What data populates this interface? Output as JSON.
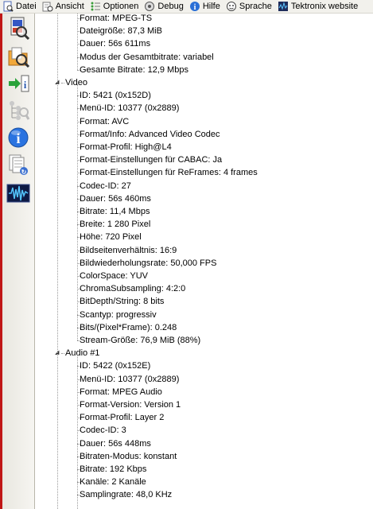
{
  "menu": [
    {
      "label": "Datei",
      "icon": "file-icon"
    },
    {
      "label": "Ansicht",
      "icon": "view-icon"
    },
    {
      "label": "Optionen",
      "icon": "options-icon"
    },
    {
      "label": "Debug",
      "icon": "debug-icon"
    },
    {
      "label": "Hilfe",
      "icon": "info-icon"
    },
    {
      "label": "Sprache",
      "icon": "language-icon"
    },
    {
      "label": "Tektronix website",
      "icon": "tektronix-icon"
    }
  ],
  "toolbar": [
    {
      "name": "open-file-icon"
    },
    {
      "name": "open-folder-icon"
    },
    {
      "name": "export-info-icon"
    },
    {
      "name": "tree-view-icon"
    },
    {
      "name": "about-icon"
    },
    {
      "name": "sheet-view-icon"
    },
    {
      "name": "waveform-icon"
    }
  ],
  "general_items": [
    "Format: MPEG-TS",
    "Dateigröße: 87,3 MiB",
    "Dauer: 56s 611ms",
    "Modus der Gesamtbitrate: variabel",
    "Gesamte Bitrate: 12,9 Mbps"
  ],
  "sections": [
    {
      "title": "Video",
      "items": [
        "ID: 5421 (0x152D)",
        "Menü-ID: 10377 (0x2889)",
        "Format: AVC",
        "Format/Info: Advanced Video Codec",
        "Format-Profil: High@L4",
        "Format-Einstellungen für CABAC: Ja",
        "Format-Einstellungen für ReFrames: 4 frames",
        "Codec-ID: 27",
        "Dauer: 56s 460ms",
        "Bitrate: 11,4 Mbps",
        "Breite: 1 280 Pixel",
        "Höhe: 720 Pixel",
        "Bildseitenverhältnis: 16:9",
        "Bildwiederholungsrate: 50,000 FPS",
        "ColorSpace: YUV",
        "ChromaSubsampling: 4:2:0",
        "BitDepth/String: 8 bits",
        "Scantyp: progressiv",
        "Bits/(Pixel*Frame): 0.248",
        "Stream-Größe: 76,9 MiB (88%)"
      ]
    },
    {
      "title": "Audio #1",
      "items": [
        "ID: 5422 (0x152E)",
        "Menü-ID: 10377 (0x2889)",
        "Format: MPEG Audio",
        "Format-Version: Version 1",
        "Format-Profil: Layer 2",
        "Codec-ID: 3",
        "Dauer: 56s 448ms",
        "Bitraten-Modus: konstant",
        "Bitrate: 192 Kbps",
        "Kanäle: 2 Kanäle",
        "Samplingrate: 48,0 KHz"
      ]
    }
  ]
}
